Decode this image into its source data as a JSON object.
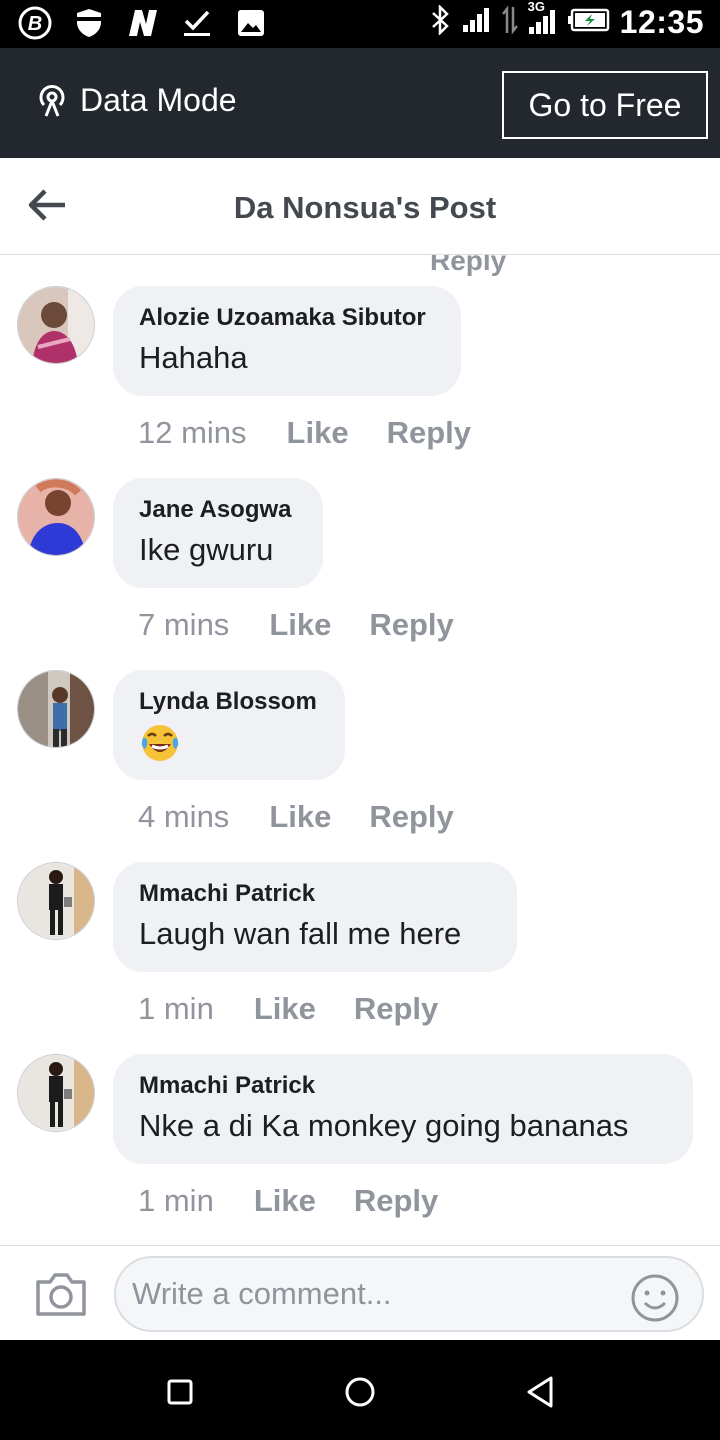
{
  "status_bar": {
    "time": "12:35",
    "network": "3G",
    "icons": [
      "b-circle-icon",
      "shield-icon",
      "n-icon",
      "check-download-icon",
      "image-icon",
      "bluetooth-icon",
      "signal-icon",
      "data-arrows-icon",
      "signal-3g-icon",
      "battery-icon"
    ]
  },
  "data_banner": {
    "label": "Data Mode",
    "icon": "broadcast-icon",
    "go_free_label": "Go to Free"
  },
  "header": {
    "title": "Da Nonsua's Post",
    "back_icon": "back-arrow-icon"
  },
  "partial_reply_label": "Reply",
  "comments": [
    {
      "author": "Alozie Uzoamaka Sibutor",
      "text": "Hahaha",
      "time": "12 mins",
      "like": "Like",
      "reply": "Reply"
    },
    {
      "author": "Jane Asogwa",
      "text": "Ike gwuru",
      "time": "7 mins",
      "like": "Like",
      "reply": "Reply"
    },
    {
      "author": "Lynda Blossom",
      "text": "",
      "emoji": "tears-of-joy-emoji",
      "time": "4 mins",
      "like": "Like",
      "reply": "Reply"
    },
    {
      "author": "Mmachi Patrick",
      "text": "Laugh wan fall me here",
      "time": "1 min",
      "like": "Like",
      "reply": "Reply"
    },
    {
      "author": "Mmachi Patrick",
      "text": "Nke a di Ka monkey going bananas",
      "time": "1 min",
      "like": "Like",
      "reply": "Reply"
    }
  ],
  "composer": {
    "placeholder": "Write a comment...",
    "value": "",
    "camera_icon": "camera-icon",
    "emoji_icon": "smiley-icon"
  },
  "colors": {
    "banner_bg": "#23272e",
    "bubble_bg": "#f0f1f4",
    "meta_gray": "#90949c",
    "title_gray": "#444950"
  }
}
